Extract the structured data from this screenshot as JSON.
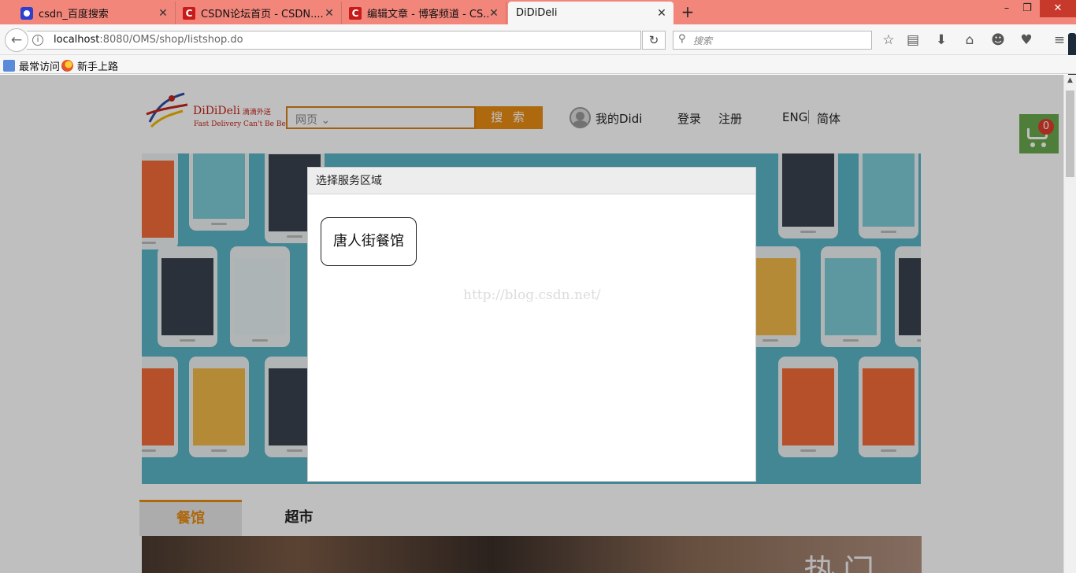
{
  "browser": {
    "tabs": [
      {
        "title": "csdn_百度搜索",
        "icon": "baidu-icon"
      },
      {
        "title": "CSDN论坛首页 - CSDN....",
        "icon": "csdn-icon"
      },
      {
        "title": "编辑文章 - 博客频道 - CS...",
        "icon": "csdn-icon"
      },
      {
        "title": "DiDiDeli",
        "icon": "none"
      }
    ],
    "url_host": "localhost",
    "url_rest": ":8080/OMS/shop/listshop.do",
    "search_placeholder": "搜索",
    "bookmarks": [
      {
        "label": "最常访问"
      },
      {
        "label": "新手上路"
      }
    ],
    "csdn_letter": "C"
  },
  "site": {
    "brand": "DiDiDeli",
    "brand_cn": "滴滴外送",
    "slogan": "Fast Delivery Can't Be Beat",
    "search_category": "网页",
    "search_button": "搜 索",
    "my_account": "我的Didi",
    "login": "登录",
    "register": "注册",
    "lang_en": "ENG",
    "lang_cn": "简体",
    "cart_count": "0",
    "tabs": [
      "餐馆",
      "超市"
    ],
    "hot_text": "热门"
  },
  "modal": {
    "title": "选择服务区域",
    "areas": [
      "唐人街餐馆"
    ],
    "watermark": "http://blog.csdn.net/"
  },
  "colors": {
    "tabbar": "#f2867b",
    "accent": "#e88b12",
    "cart": "#6aa84f",
    "banner": "#5ab3c6"
  }
}
